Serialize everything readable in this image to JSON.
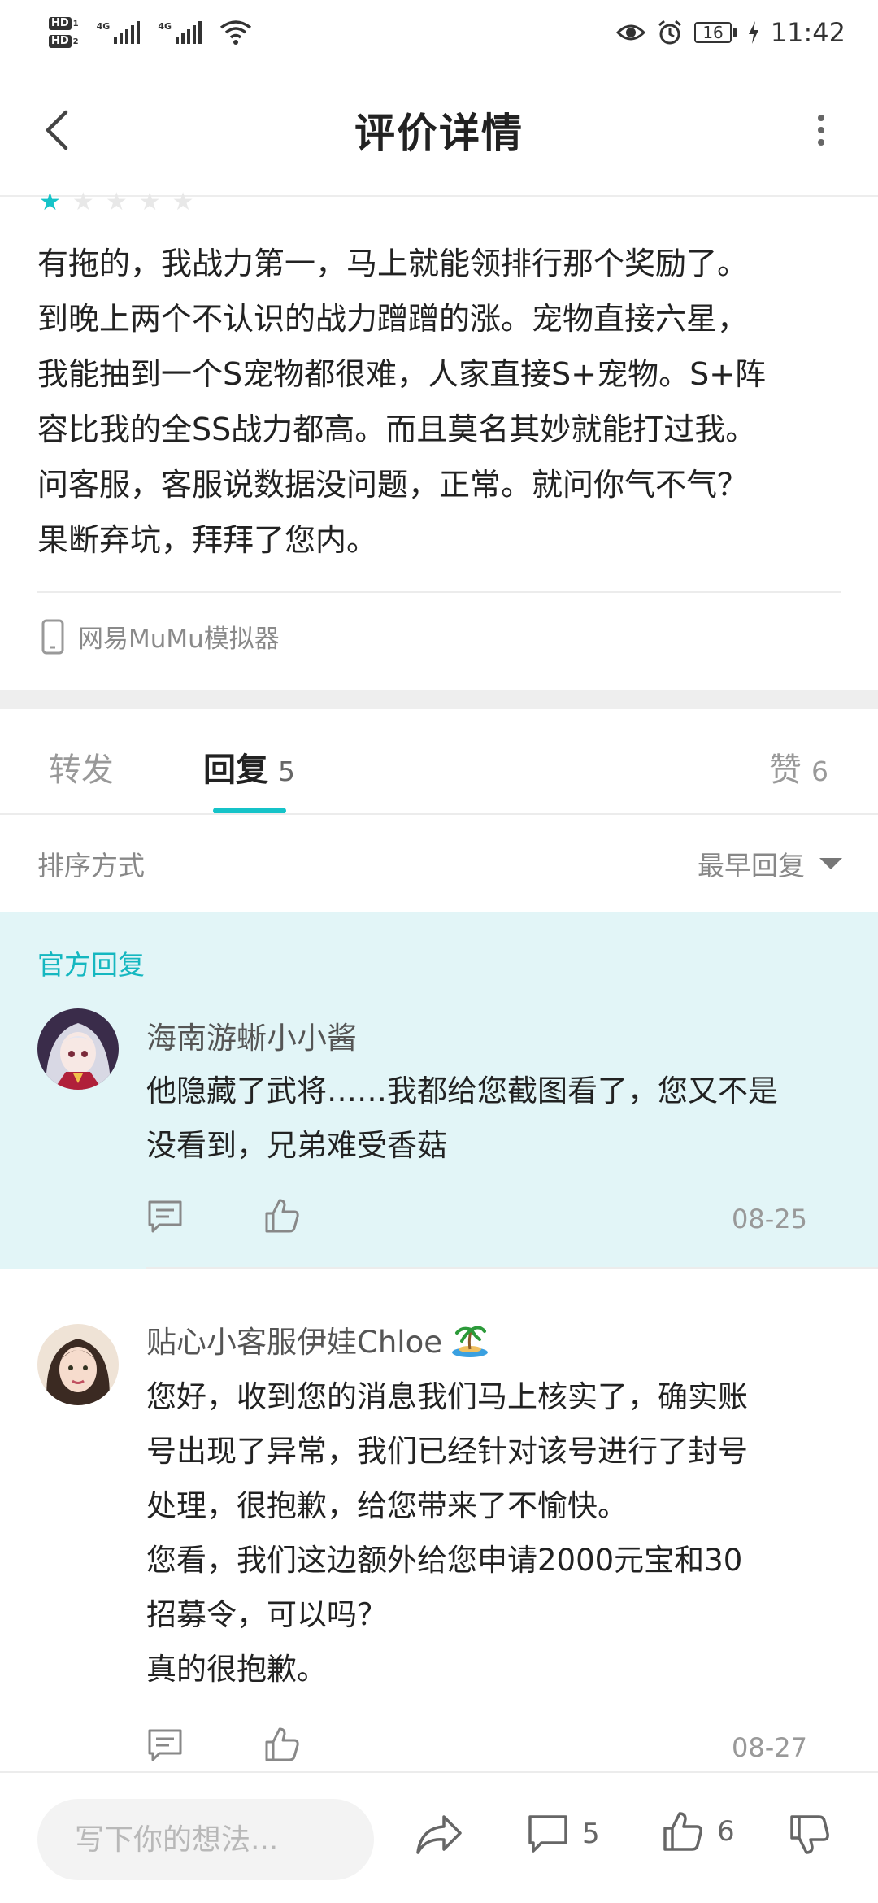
{
  "status_bar": {
    "time": "11:42",
    "battery": "16",
    "hd1": "HD",
    "hd1_sub": "1",
    "hd2": "HD",
    "hd2_sub": "2",
    "net1": "4G",
    "net2": "4G"
  },
  "header": {
    "title": "评价详情"
  },
  "review": {
    "stars_total": 5,
    "stars_filled": 1,
    "text": "有拖的，我战力第一，马上就能领排行那个奖励了。\n到晚上两个不认识的战力蹭蹭的涨。宠物直接六星，\n我能抽到一个S宠物都很难，人家直接S+宠物。S+阵\n容比我的全SS战力都高。而且莫名其妙就能打过我。\n问客服，客服说数据没问题，正常。就问你气不气？\n果断弃坑，拜拜了您内。",
    "device": "网易MuMu模拟器"
  },
  "tabs": [
    {
      "label": "转发",
      "count": ""
    },
    {
      "label": "回复",
      "count": "5"
    },
    {
      "label": "赞",
      "count": "6"
    }
  ],
  "sort": {
    "label": "排序方式",
    "value": "最早回复"
  },
  "official_reply": {
    "label": "官方回复",
    "author": "海南游蜥小小酱",
    "text": "他隐藏了武将……我都给您截图看了，您又不是\n没看到，兄弟难受香菇",
    "date": "08-25"
  },
  "reply2": {
    "author": "贴心小客服伊娃Chloe",
    "author_emoji": "🏝",
    "text": "您好，收到您的消息我们马上核实了，确实账\n号出现了异常，我们已经针对该号进行了封号\n处理，很抱歉，给您带来了不愉快。\n您看，我们这边额外给您申请2000元宝和30\n招募令，可以吗？\n真的很抱歉。",
    "date": "08-27"
  },
  "bottom_bar": {
    "input_placeholder": "写下你的想法...",
    "comment_count": "5",
    "like_count": "6"
  },
  "colors": {
    "accent": "#15c3c8",
    "official_bg": "#e2f5f7"
  }
}
